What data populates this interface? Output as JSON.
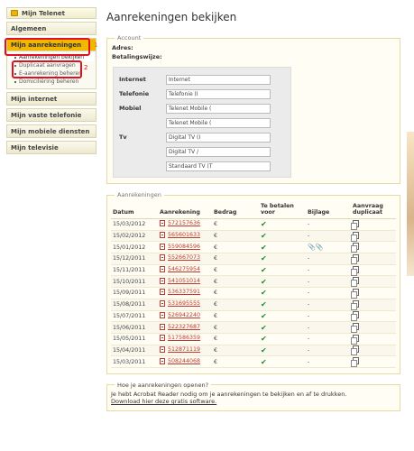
{
  "sidebar": {
    "top_label": "Mijn Telenet",
    "general": "Algemeen",
    "invoices_section": "Mijn aanrekeningen",
    "invoices_items": [
      "Aanrekeningen bekijken",
      "Duplicaat aanvragen",
      "E-aanrekening beheren",
      "Domiciliëring beheren"
    ],
    "other_sections": [
      "Mijn internet",
      "Mijn vaste telefonie",
      "Mijn mobiele diensten",
      "Mijn televisie"
    ],
    "step1": "1",
    "step2": "2"
  },
  "main": {
    "title": "Aanrekeningen bekijken",
    "account": {
      "legend": "Account",
      "address_label": "Adres:",
      "payment_label": "Betalingswijze:",
      "rows": [
        {
          "label": "Internet",
          "value": "Internet"
        },
        {
          "label": "Telefonie",
          "value": "Telefonie (I"
        },
        {
          "label": "Mobiel",
          "value": "Telenet Mobile ("
        },
        {
          "label": "",
          "value": "Telenet Mobile ("
        },
        {
          "label": "Tv",
          "value": "Digital TV (I"
        },
        {
          "label": "",
          "value": "Digital TV /"
        },
        {
          "label": "",
          "value": "Standaard TV (T"
        }
      ]
    },
    "invoices": {
      "legend": "Aanrekeningen",
      "headers": [
        "Datum",
        "Aanrekening",
        "Bedrag",
        "Te betalen voor",
        "Bijlage",
        "Aanvraag duplicaat"
      ],
      "rows": [
        {
          "date": "15/03/2012",
          "number": "572157636",
          "amount": "€",
          "attachment": "-"
        },
        {
          "date": "15/02/2012",
          "number": "565601633",
          "amount": "€",
          "attachment": "-"
        },
        {
          "date": "15/01/2012",
          "number": "559084596",
          "amount": "€",
          "attachment": "clips"
        },
        {
          "date": "15/12/2011",
          "number": "552667073",
          "amount": "€",
          "attachment": "-"
        },
        {
          "date": "15/11/2011",
          "number": "546275954",
          "amount": "€",
          "attachment": "-"
        },
        {
          "date": "15/10/2011",
          "number": "541051014",
          "amount": "€",
          "attachment": "-"
        },
        {
          "date": "15/09/2011",
          "number": "536337591",
          "amount": "€",
          "attachment": "-"
        },
        {
          "date": "15/08/2011",
          "number": "531695555",
          "amount": "€",
          "attachment": "-"
        },
        {
          "date": "15/07/2011",
          "number": "526942240",
          "amount": "€",
          "attachment": "-"
        },
        {
          "date": "15/06/2011",
          "number": "522327687",
          "amount": "€",
          "attachment": "-"
        },
        {
          "date": "15/05/2011",
          "number": "517586359",
          "amount": "€",
          "attachment": "-"
        },
        {
          "date": "15/04/2011",
          "number": "512871119",
          "amount": "€",
          "attachment": "-"
        },
        {
          "date": "15/03/2011",
          "number": "508244068",
          "amount": "€",
          "attachment": "-"
        }
      ]
    },
    "help": {
      "legend": "Hoe je aanrekeningen openen?",
      "text": "Je hebt Acrobat Reader nodig om je aanrekeningen te bekijken en af te drukken.",
      "link": "Download hier deze gratis software."
    }
  }
}
